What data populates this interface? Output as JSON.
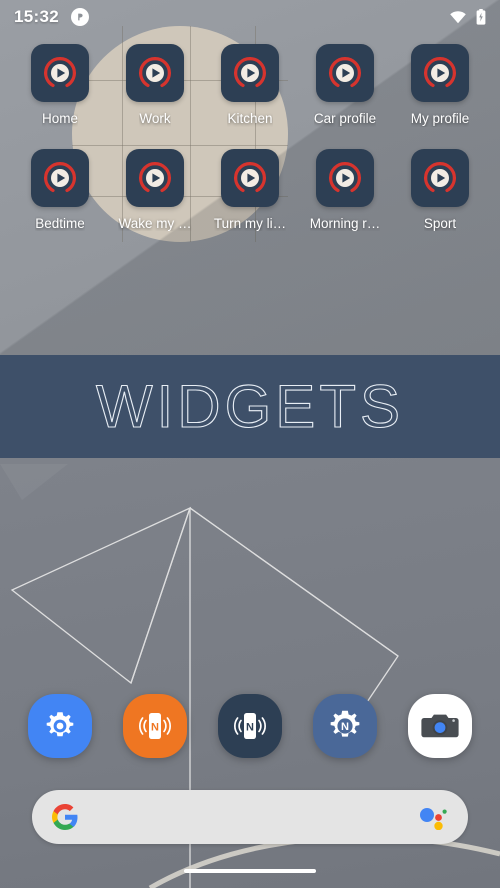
{
  "status_bar": {
    "clock": "15:32",
    "notification_icon": "app-notification-icon",
    "wifi_icon": "wifi-icon",
    "battery_icon": "battery-charging-icon"
  },
  "home_screen": {
    "app_rows": [
      [
        {
          "label": "Home",
          "icon": "play-shortcut-icon"
        },
        {
          "label": "Work",
          "icon": "play-shortcut-icon"
        },
        {
          "label": "Kitchen",
          "icon": "play-shortcut-icon"
        },
        {
          "label": "Car profile",
          "icon": "play-shortcut-icon"
        },
        {
          "label": "My profile",
          "icon": "play-shortcut-icon"
        }
      ],
      [
        {
          "label": "Bedtime",
          "icon": "play-shortcut-icon"
        },
        {
          "label": "Wake my …",
          "icon": "play-shortcut-icon"
        },
        {
          "label": "Turn my li…",
          "icon": "play-shortcut-icon"
        },
        {
          "label": "Morning r…",
          "icon": "play-shortcut-icon"
        },
        {
          "label": "Sport",
          "icon": "play-shortcut-icon"
        }
      ]
    ]
  },
  "widgets_banner": {
    "title": "WIDGETS",
    "background_color": "#3e5069",
    "text_color": "#e8eef5"
  },
  "dock": {
    "items": [
      {
        "name": "settings",
        "icon": "gear-icon",
        "color": "#4285f4"
      },
      {
        "name": "nfc-tools-write",
        "icon": "nfc-phone-icon",
        "color": "#ef7622"
      },
      {
        "name": "nfc-tools",
        "icon": "nfc-phone-icon",
        "color": "#2d3f54"
      },
      {
        "name": "nfc-settings",
        "icon": "gear-n-icon",
        "color": "#4a6898"
      },
      {
        "name": "camera",
        "icon": "camera-icon",
        "color": "#ffffff"
      }
    ]
  },
  "search": {
    "placeholder": "",
    "value": "",
    "google_icon": "google-g-icon",
    "assistant_icon": "google-assistant-icon",
    "background_color": "#e4e4e4"
  },
  "navigation": {
    "gesture_pill": "gesture-nav-pill"
  },
  "theme": {
    "app_icon_background": "#2d3f54",
    "app_icon_ring": "#d7342e",
    "wallpaper_base": "#8f9399",
    "wallpaper_circle": "#cfc7ba"
  }
}
